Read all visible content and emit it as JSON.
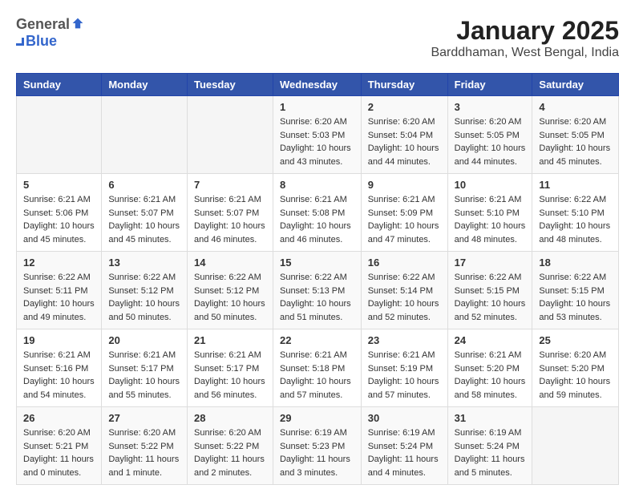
{
  "logo": {
    "general": "General",
    "blue": "Blue"
  },
  "title": "January 2025",
  "subtitle": "Barddhaman, West Bengal, India",
  "days_of_week": [
    "Sunday",
    "Monday",
    "Tuesday",
    "Wednesday",
    "Thursday",
    "Friday",
    "Saturday"
  ],
  "weeks": [
    [
      {
        "day": "",
        "sunrise": "",
        "sunset": "",
        "daylight": ""
      },
      {
        "day": "",
        "sunrise": "",
        "sunset": "",
        "daylight": ""
      },
      {
        "day": "",
        "sunrise": "",
        "sunset": "",
        "daylight": ""
      },
      {
        "day": "1",
        "sunrise": "Sunrise: 6:20 AM",
        "sunset": "Sunset: 5:03 PM",
        "daylight": "Daylight: 10 hours and 43 minutes."
      },
      {
        "day": "2",
        "sunrise": "Sunrise: 6:20 AM",
        "sunset": "Sunset: 5:04 PM",
        "daylight": "Daylight: 10 hours and 44 minutes."
      },
      {
        "day": "3",
        "sunrise": "Sunrise: 6:20 AM",
        "sunset": "Sunset: 5:05 PM",
        "daylight": "Daylight: 10 hours and 44 minutes."
      },
      {
        "day": "4",
        "sunrise": "Sunrise: 6:20 AM",
        "sunset": "Sunset: 5:05 PM",
        "daylight": "Daylight: 10 hours and 45 minutes."
      }
    ],
    [
      {
        "day": "5",
        "sunrise": "Sunrise: 6:21 AM",
        "sunset": "Sunset: 5:06 PM",
        "daylight": "Daylight: 10 hours and 45 minutes."
      },
      {
        "day": "6",
        "sunrise": "Sunrise: 6:21 AM",
        "sunset": "Sunset: 5:07 PM",
        "daylight": "Daylight: 10 hours and 45 minutes."
      },
      {
        "day": "7",
        "sunrise": "Sunrise: 6:21 AM",
        "sunset": "Sunset: 5:07 PM",
        "daylight": "Daylight: 10 hours and 46 minutes."
      },
      {
        "day": "8",
        "sunrise": "Sunrise: 6:21 AM",
        "sunset": "Sunset: 5:08 PM",
        "daylight": "Daylight: 10 hours and 46 minutes."
      },
      {
        "day": "9",
        "sunrise": "Sunrise: 6:21 AM",
        "sunset": "Sunset: 5:09 PM",
        "daylight": "Daylight: 10 hours and 47 minutes."
      },
      {
        "day": "10",
        "sunrise": "Sunrise: 6:21 AM",
        "sunset": "Sunset: 5:10 PM",
        "daylight": "Daylight: 10 hours and 48 minutes."
      },
      {
        "day": "11",
        "sunrise": "Sunrise: 6:22 AM",
        "sunset": "Sunset: 5:10 PM",
        "daylight": "Daylight: 10 hours and 48 minutes."
      }
    ],
    [
      {
        "day": "12",
        "sunrise": "Sunrise: 6:22 AM",
        "sunset": "Sunset: 5:11 PM",
        "daylight": "Daylight: 10 hours and 49 minutes."
      },
      {
        "day": "13",
        "sunrise": "Sunrise: 6:22 AM",
        "sunset": "Sunset: 5:12 PM",
        "daylight": "Daylight: 10 hours and 50 minutes."
      },
      {
        "day": "14",
        "sunrise": "Sunrise: 6:22 AM",
        "sunset": "Sunset: 5:12 PM",
        "daylight": "Daylight: 10 hours and 50 minutes."
      },
      {
        "day": "15",
        "sunrise": "Sunrise: 6:22 AM",
        "sunset": "Sunset: 5:13 PM",
        "daylight": "Daylight: 10 hours and 51 minutes."
      },
      {
        "day": "16",
        "sunrise": "Sunrise: 6:22 AM",
        "sunset": "Sunset: 5:14 PM",
        "daylight": "Daylight: 10 hours and 52 minutes."
      },
      {
        "day": "17",
        "sunrise": "Sunrise: 6:22 AM",
        "sunset": "Sunset: 5:15 PM",
        "daylight": "Daylight: 10 hours and 52 minutes."
      },
      {
        "day": "18",
        "sunrise": "Sunrise: 6:22 AM",
        "sunset": "Sunset: 5:15 PM",
        "daylight": "Daylight: 10 hours and 53 minutes."
      }
    ],
    [
      {
        "day": "19",
        "sunrise": "Sunrise: 6:21 AM",
        "sunset": "Sunset: 5:16 PM",
        "daylight": "Daylight: 10 hours and 54 minutes."
      },
      {
        "day": "20",
        "sunrise": "Sunrise: 6:21 AM",
        "sunset": "Sunset: 5:17 PM",
        "daylight": "Daylight: 10 hours and 55 minutes."
      },
      {
        "day": "21",
        "sunrise": "Sunrise: 6:21 AM",
        "sunset": "Sunset: 5:17 PM",
        "daylight": "Daylight: 10 hours and 56 minutes."
      },
      {
        "day": "22",
        "sunrise": "Sunrise: 6:21 AM",
        "sunset": "Sunset: 5:18 PM",
        "daylight": "Daylight: 10 hours and 57 minutes."
      },
      {
        "day": "23",
        "sunrise": "Sunrise: 6:21 AM",
        "sunset": "Sunset: 5:19 PM",
        "daylight": "Daylight: 10 hours and 57 minutes."
      },
      {
        "day": "24",
        "sunrise": "Sunrise: 6:21 AM",
        "sunset": "Sunset: 5:20 PM",
        "daylight": "Daylight: 10 hours and 58 minutes."
      },
      {
        "day": "25",
        "sunrise": "Sunrise: 6:20 AM",
        "sunset": "Sunset: 5:20 PM",
        "daylight": "Daylight: 10 hours and 59 minutes."
      }
    ],
    [
      {
        "day": "26",
        "sunrise": "Sunrise: 6:20 AM",
        "sunset": "Sunset: 5:21 PM",
        "daylight": "Daylight: 11 hours and 0 minutes."
      },
      {
        "day": "27",
        "sunrise": "Sunrise: 6:20 AM",
        "sunset": "Sunset: 5:22 PM",
        "daylight": "Daylight: 11 hours and 1 minute."
      },
      {
        "day": "28",
        "sunrise": "Sunrise: 6:20 AM",
        "sunset": "Sunset: 5:22 PM",
        "daylight": "Daylight: 11 hours and 2 minutes."
      },
      {
        "day": "29",
        "sunrise": "Sunrise: 6:19 AM",
        "sunset": "Sunset: 5:23 PM",
        "daylight": "Daylight: 11 hours and 3 minutes."
      },
      {
        "day": "30",
        "sunrise": "Sunrise: 6:19 AM",
        "sunset": "Sunset: 5:24 PM",
        "daylight": "Daylight: 11 hours and 4 minutes."
      },
      {
        "day": "31",
        "sunrise": "Sunrise: 6:19 AM",
        "sunset": "Sunset: 5:24 PM",
        "daylight": "Daylight: 11 hours and 5 minutes."
      },
      {
        "day": "",
        "sunrise": "",
        "sunset": "",
        "daylight": ""
      }
    ]
  ]
}
